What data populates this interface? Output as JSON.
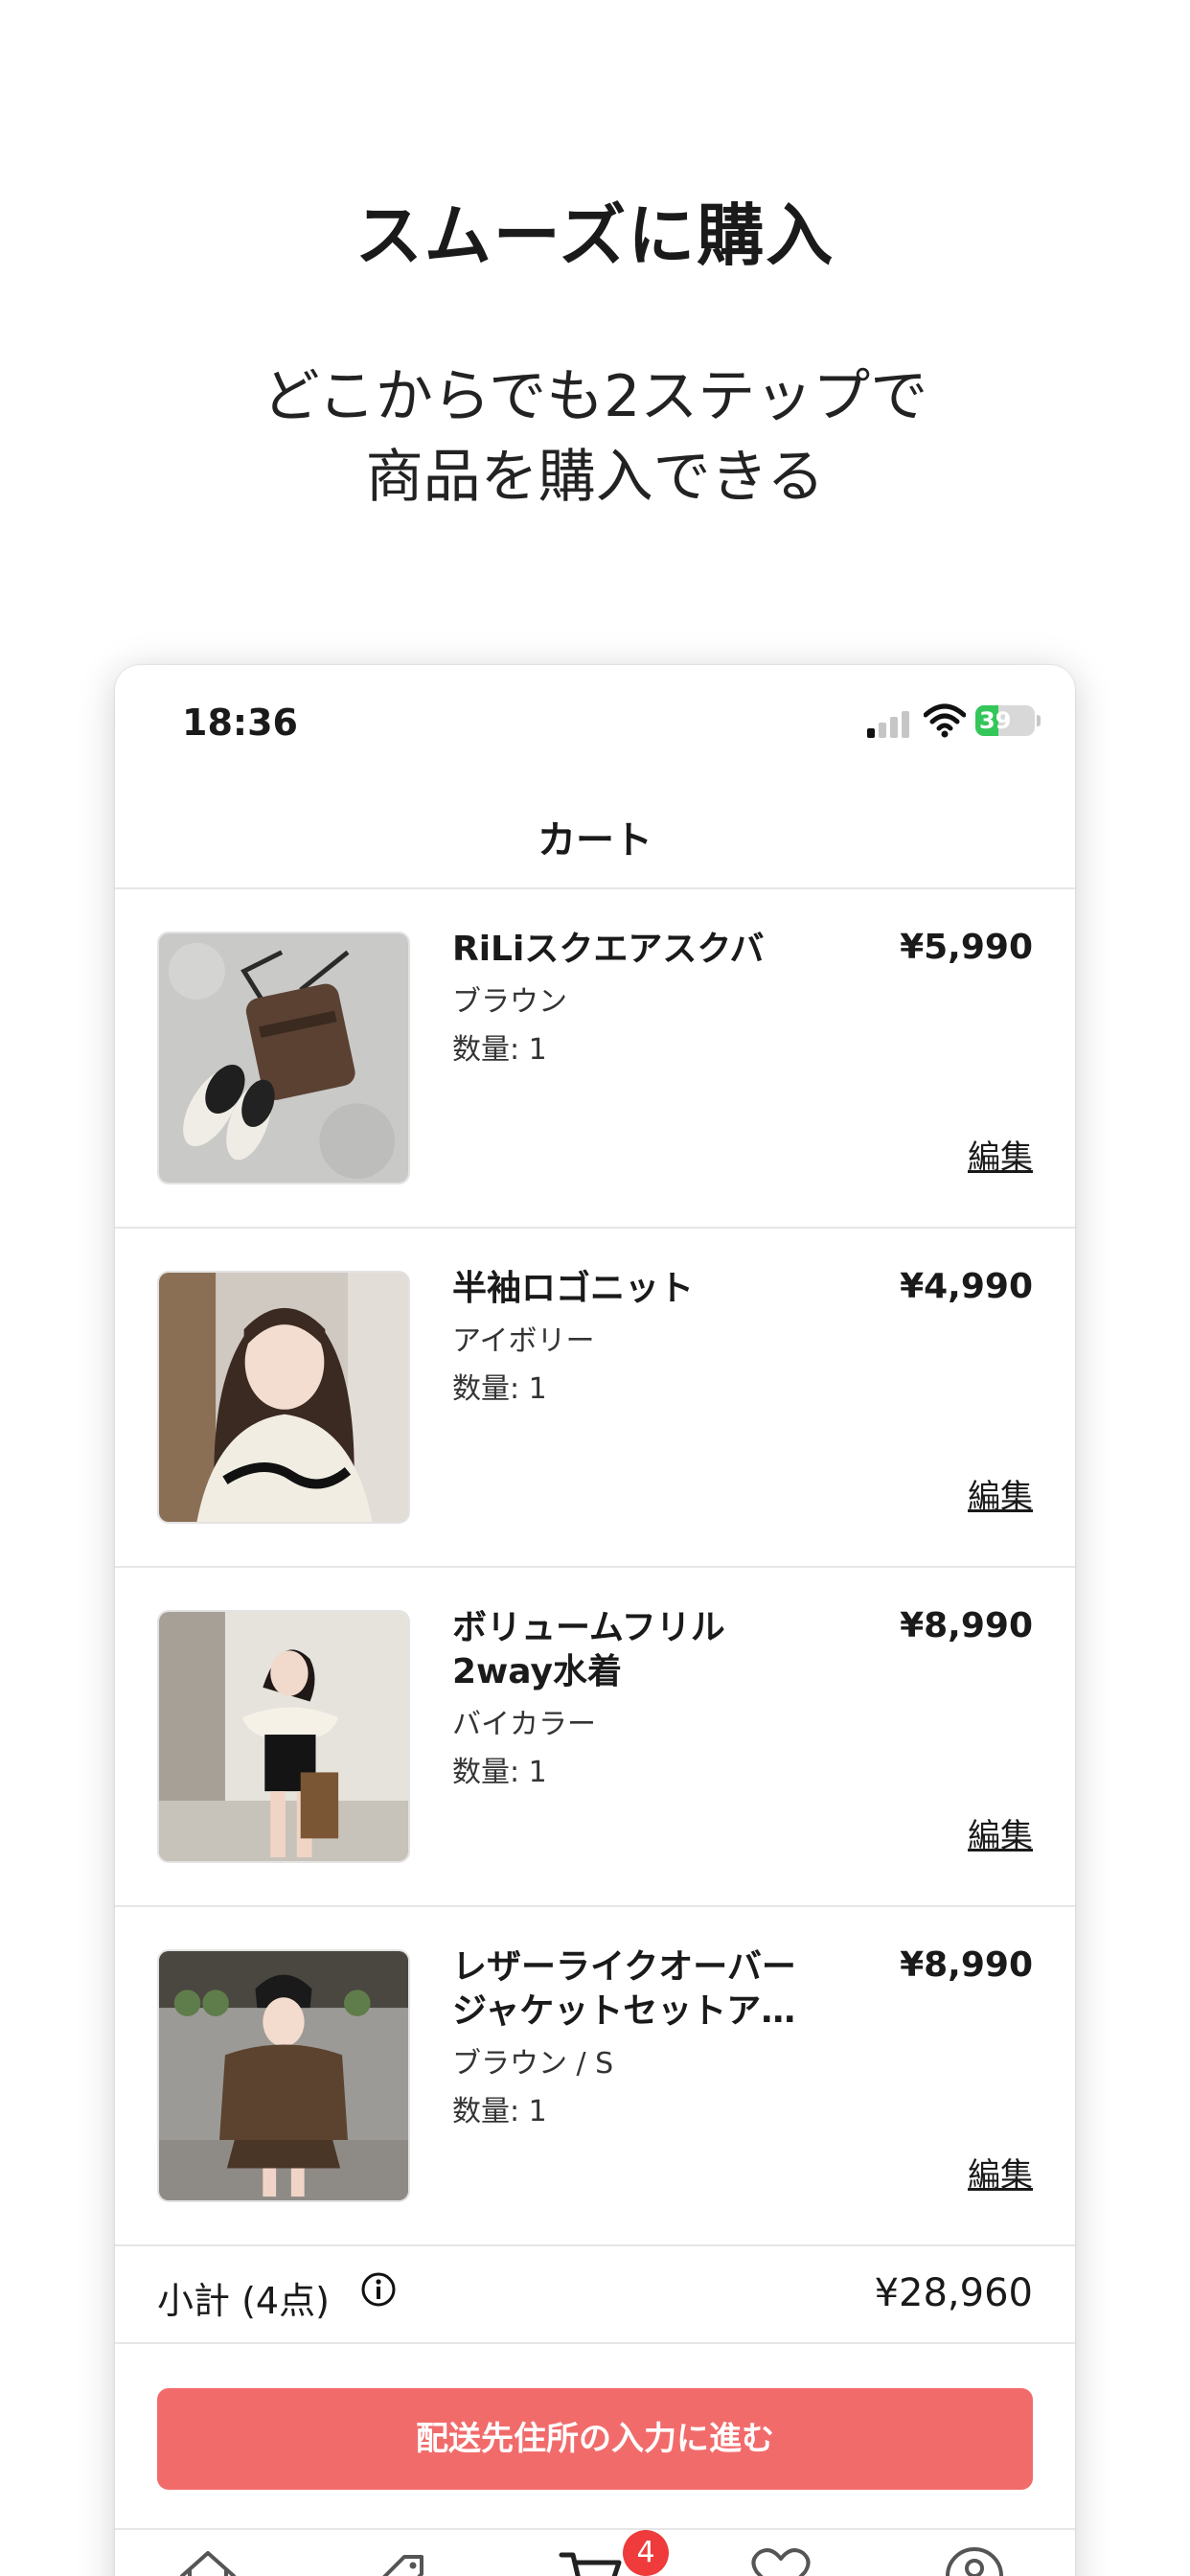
{
  "promo": {
    "headline": "スムーズに購入",
    "subline_1": "どこからでも2ステップで",
    "subline_2": "商品を購入できる"
  },
  "status_bar": {
    "time": "18:36",
    "battery": "39"
  },
  "nav": {
    "title": "カート"
  },
  "cart_items": [
    {
      "name_1": "RiLiスクエアスクバ",
      "name_2": "",
      "price": "¥5,990",
      "variant": "ブラウン",
      "quantity": "数量: 1",
      "edit": "編集"
    },
    {
      "name_1": "半袖ロゴニット",
      "name_2": "",
      "price": "¥4,990",
      "variant": "アイボリー",
      "quantity": "数量: 1",
      "edit": "編集"
    },
    {
      "name_1": "ボリュームフリル",
      "name_2": "2way水着",
      "price": "¥8,990",
      "variant": "バイカラー",
      "quantity": "数量: 1",
      "edit": "編集"
    },
    {
      "name_1": "レザーライクオーバー",
      "name_2": "ジャケットセットア…",
      "price": "¥8,990",
      "variant": "ブラウン / S",
      "quantity": "数量: 1",
      "edit": "編集"
    }
  ],
  "subtotal": {
    "label": "小計 (4点)",
    "value": "¥28,960"
  },
  "checkout_button": "配送先住所の入力に進む",
  "tab_bar": {
    "cart_badge": "4"
  },
  "colors": {
    "accent": "#f26b6b",
    "badge": "#ef3b3b",
    "battery": "#33c759"
  }
}
